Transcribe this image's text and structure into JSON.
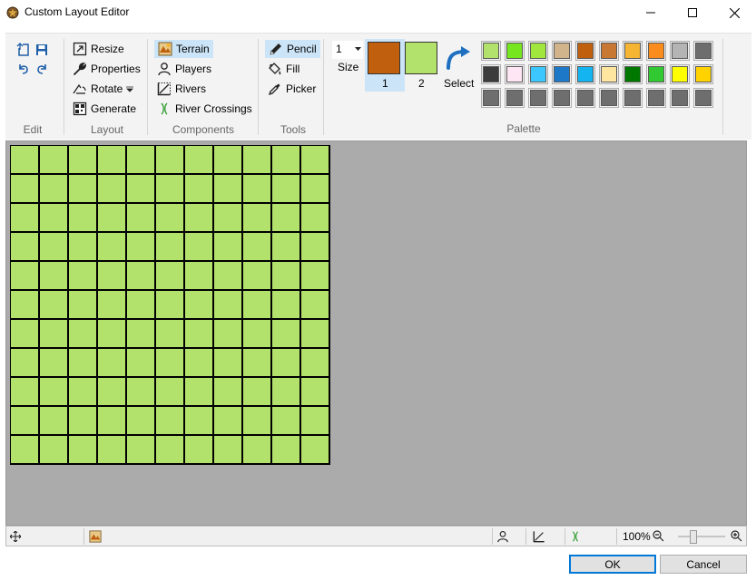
{
  "window": {
    "title": "Custom Layout Editor"
  },
  "ribbon": {
    "groups": {
      "edit": "Edit",
      "layout": "Layout",
      "components": "Components",
      "tools": "Tools",
      "palette": "Palette"
    },
    "layout": {
      "resize": "Resize",
      "properties": "Properties",
      "rotate": "Rotate",
      "generate": "Generate"
    },
    "components": {
      "terrain": "Terrain",
      "players": "Players",
      "rivers": "Rivers",
      "river_crossings": "River Crossings",
      "selected": "terrain"
    },
    "tools": {
      "pencil": "Pencil",
      "fill": "Fill",
      "picker": "Picker",
      "selected": "pencil"
    },
    "size": {
      "value": "1",
      "label": "Size"
    },
    "colors": {
      "primary_color": "#c0600f",
      "secondary_color": "#b3e26c",
      "primary_label": "1",
      "secondary_label": "2",
      "select_label": "Select"
    },
    "palette_rows": [
      [
        "#b3e26c",
        "#76e61e",
        "#a0e63c",
        "#d2b48c",
        "#c0600f",
        "#c87832",
        "#f5b432",
        "#fa8c1e",
        "#b4b4b4",
        "#6e6e6e"
      ],
      [
        "#3c3c3c",
        "#ffe6f5",
        "#3cc8ff",
        "#1e78c8",
        "#14b4f0",
        "#ffe6a0",
        "#007800",
        "#32c832",
        "#ffff00",
        "#ffd200"
      ],
      [
        "#6e6e6e",
        "#6e6e6e",
        "#6e6e6e",
        "#6e6e6e",
        "#6e6e6e",
        "#6e6e6e",
        "#6e6e6e",
        "#6e6e6e",
        "#6e6e6e",
        "#6e6e6e"
      ]
    ]
  },
  "map": {
    "rows": 11,
    "cols": 11,
    "tile_color": "#b3e26c"
  },
  "status": {
    "zoom": "100%"
  },
  "buttons": {
    "ok": "OK",
    "cancel": "Cancel"
  }
}
